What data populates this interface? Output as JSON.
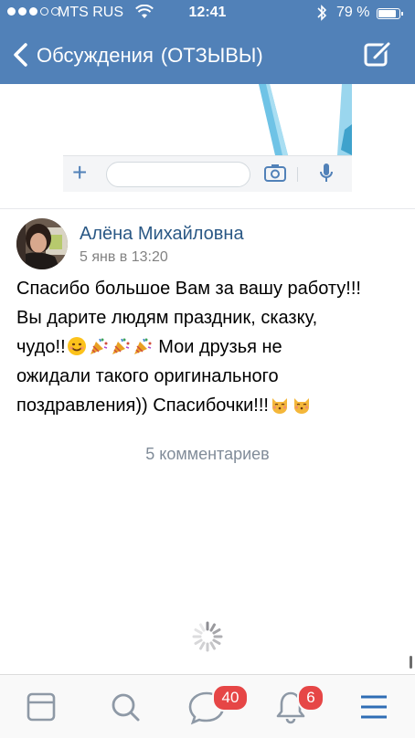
{
  "status_bar": {
    "carrier": "MTS RUS",
    "time": "12:41",
    "battery": "79 %",
    "battery_level": 0.79,
    "signal_bars_filled": 3,
    "signal_bars_total": 5
  },
  "nav": {
    "title": "Обсуждения",
    "subtitle": "(ОТЗЫВЫ)"
  },
  "post": {
    "author": "Алёна Михайловна",
    "date": "5 янв в 13:20",
    "text_line1": "Спасибо большое Вам за вашу работу!!!",
    "text_line2": "Вы дарите людям праздник, сказку,",
    "text_line3a": "чудо!!",
    "text_line3b": "Мои друзья не",
    "text_line4": "ожидали такого оригинального",
    "text_line5": "поздравления)) Спасибочки!!!",
    "comments": "5 комментариев"
  },
  "tabbar": {
    "messages_badge": "40",
    "notifications_badge": "6"
  },
  "colors": {
    "header": "#5181b8",
    "link": "#2a5885",
    "badge": "#e64646",
    "active_tab": "#2f6db5",
    "inactive_tab": "#8e99a6"
  }
}
